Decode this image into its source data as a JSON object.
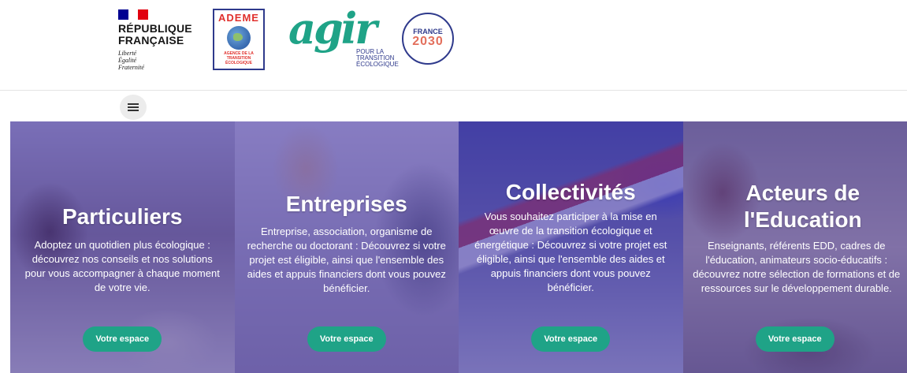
{
  "header": {
    "republique": {
      "line1": "RÉPUBLIQUE",
      "line2": "FRANÇAISE",
      "motto1": "Liberté",
      "motto2": "Égalité",
      "motto3": "Fraternité"
    },
    "ademe": {
      "name": "ADEME",
      "sub1": "AGENCE DE LA",
      "sub2": "TRANSITION",
      "sub3": "ÉCOLOGIQUE"
    },
    "agir": {
      "word": "agir",
      "sub1": "POUR LA",
      "sub2": "TRANSITION",
      "sub3": "ÉCOLOGIQUE"
    },
    "france2030": {
      "line1": "FRANCE",
      "line2": "2030"
    },
    "menu_icon": "hamburger-icon"
  },
  "colors": {
    "overlay": "#4637aa",
    "button": "#1fa387",
    "flag_blue": "#000091",
    "flag_red": "#e1000f"
  },
  "cards": [
    {
      "title": "Particuliers",
      "text": "Adoptez un quotidien plus écologique : découvrez nos conseils et nos solutions pour vous accompagner à chaque moment de votre vie.",
      "button": "Votre espace"
    },
    {
      "title": "Entreprises",
      "text": "Entreprise, association, organisme de recherche ou doctorant : Découvrez si votre projet est éligible, ainsi que l'ensemble des aides et appuis financiers dont vous pouvez bénéficier.",
      "button": "Votre espace"
    },
    {
      "title": "Collectivités",
      "text": "Vous souhaitez participer à la mise en œuvre de la transition écologique et énergétique : Découvrez si votre projet est éligible, ainsi que l'ensemble des aides et appuis financiers dont vous pouvez bénéficier.",
      "button": "Votre espace"
    },
    {
      "title": "Acteurs de l'Education",
      "text": "Enseignants, référents EDD, cadres de l'éducation, animateurs socio-éducatifs : découvrez notre sélection de formations et de ressources sur le développement durable.",
      "button": "Votre espace"
    }
  ]
}
